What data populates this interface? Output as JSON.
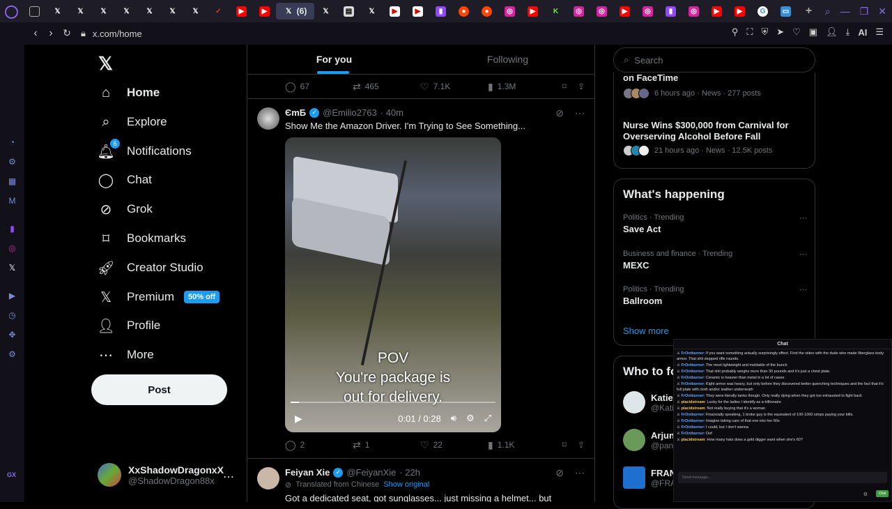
{
  "browser": {
    "active_tab_badge": "(6)",
    "url": "x.com/home",
    "ai_label": "AI",
    "gx_label": "GX"
  },
  "nav": {
    "items": [
      {
        "label": "Home"
      },
      {
        "label": "Explore"
      },
      {
        "label": "Notifications",
        "badge": "6"
      },
      {
        "label": "Chat"
      },
      {
        "label": "Grok"
      },
      {
        "label": "Bookmarks"
      },
      {
        "label": "Creator Studio"
      },
      {
        "label": "Premium",
        "promo": "50% off"
      },
      {
        "label": "Profile"
      },
      {
        "label": "More"
      }
    ],
    "post_label": "Post",
    "account": {
      "name": "XxShadowDragonxX",
      "handle": "@ShadowDragon88x"
    }
  },
  "feed": {
    "tabs": [
      "For you",
      "Following"
    ],
    "prev_tweet_actions": {
      "replies": "67",
      "reposts": "465",
      "likes": "7.1K",
      "views": "1.3M"
    },
    "tweet1": {
      "name": "ЄmБ",
      "handle": "@Emilio2763",
      "time": "· 40m",
      "text": "Show Me the Amazon Driver. I'm Trying to See Something...",
      "caption_lines": [
        "POV",
        "You're package is",
        "out for delivery."
      ],
      "video_time": "0:01 / 0:28",
      "progress": 0.04,
      "actions": {
        "replies": "2",
        "reposts": "1",
        "likes": "22",
        "views": "1.1K"
      }
    },
    "tweet2": {
      "name": "Feiyan Xie",
      "handle": "@FeiyanXie",
      "time": "· 22h",
      "translated": "Translated from Chinese",
      "show_original": "Show original",
      "text": "Got a dedicated seat, got sunglasses... just missing a helmet... but"
    }
  },
  "rail": {
    "search_placeholder": "Search",
    "news": [
      {
        "title": "on FaceTime",
        "meta": "6 hours ago · News · 277 posts"
      },
      {
        "title": "Nurse Wins $300,000 from Carnival for Overserving Alcohol Before Fall",
        "meta": "21 hours ago · News · 12.5K posts"
      }
    ],
    "happening_title": "What's happening",
    "trends": [
      {
        "context": "Politics · Trending",
        "name": "Save Act"
      },
      {
        "context": "Business and finance · Trending",
        "name": "MEXC"
      },
      {
        "context": "Politics · Trending",
        "name": "Ballroom"
      }
    ],
    "show_more": "Show more",
    "wtf_title": "Who to follow",
    "wtf_users": [
      {
        "name": "Katie",
        "handle": "@Kati"
      },
      {
        "name": "Arjun",
        "handle": "@pan"
      },
      {
        "name": "FRAN",
        "handle": "@FRA"
      }
    ]
  },
  "chat": {
    "title": "Chat",
    "messages": [
      {
        "user": "FrOntburner",
        "text": "If you want something actually surprisingly effect. Find the video with the dude who made fiberglass body armor. That shit stopped rifle rounds."
      },
      {
        "user": "FrOntburner",
        "text": "The most lightweight and moldable of the bunch"
      },
      {
        "user": "FrOntburner",
        "text": "That shit probably weighs more than 30 pounds and it's just a chest plate."
      },
      {
        "user": "FrOntburner",
        "text": "Ceramic is heavier than metal in a lot of cases"
      },
      {
        "user": "FrOntburner",
        "text": "Kight armor was heavy, but only before they discovered better quenching techniques and the fact that it's full plate with cloth and/or leather underneath"
      },
      {
        "user": "FrOntburner",
        "text": "They were literally tanks though. Only really dying when they got too exhausted to fight back"
      },
      {
        "user": "placidstream",
        "text": "Lucky for the ladies I identify as a trillionaire"
      },
      {
        "user": "placidstream",
        "text": "Not really buying that it's a woman"
      },
      {
        "user": "FrOntburner",
        "text": "Financially speaking, 1 broke guy is the equivalent of 100-1000 simps paying your bills."
      },
      {
        "user": "FrOntburner",
        "text": "Imagine taking care of that one into her 60s"
      },
      {
        "user": "FrOntburner",
        "text": "I could, but I don't wanna"
      },
      {
        "user": "FrOntburner",
        "text": "Oof"
      },
      {
        "user": "placidstream",
        "text": "How many hats does a gold digger want when she's 60?"
      }
    ],
    "input_placeholder": "Send message...",
    "send_label": "Chat"
  },
  "colors": {
    "accent": "#1d9bf0",
    "bg": "#000000",
    "text": "#e7e9ea",
    "muted": "#71767b",
    "opera": "#8b6cf0"
  }
}
